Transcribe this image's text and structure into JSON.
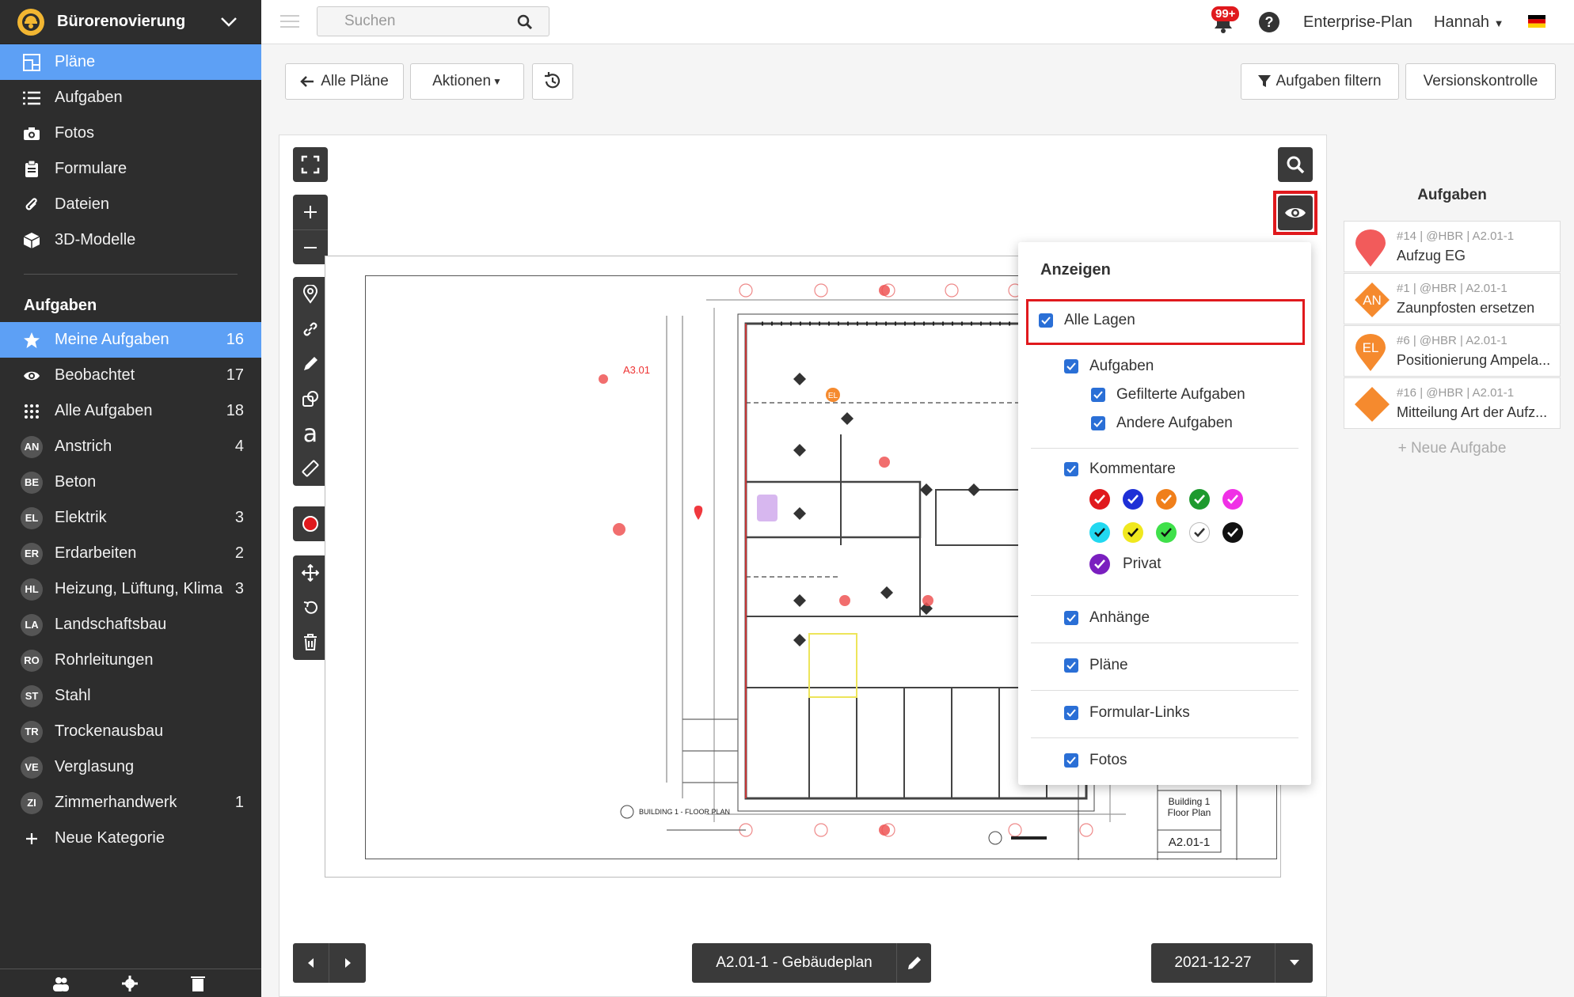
{
  "project": {
    "name": "Bürorenovierung"
  },
  "nav": [
    {
      "label": "Pläne",
      "icon": "plans-icon"
    },
    {
      "label": "Aufgaben",
      "icon": "list-icon"
    },
    {
      "label": "Fotos",
      "icon": "camera-icon"
    },
    {
      "label": "Formulare",
      "icon": "clipboard-icon"
    },
    {
      "label": "Dateien",
      "icon": "paperclip-icon"
    },
    {
      "label": "3D-Modelle",
      "icon": "cube-icon"
    }
  ],
  "tasks_section": {
    "title": "Aufgaben",
    "items": [
      {
        "label": "Meine Aufgaben",
        "count": "16",
        "icon": "star-icon"
      },
      {
        "label": "Beobachtet",
        "count": "17",
        "icon": "eye-icon"
      },
      {
        "label": "Alle Aufgaben",
        "count": "18",
        "icon": "grid-icon"
      }
    ],
    "categories": [
      {
        "abbr": "AN",
        "label": "Anstrich",
        "count": "4"
      },
      {
        "abbr": "BE",
        "label": "Beton",
        "count": ""
      },
      {
        "abbr": "EL",
        "label": "Elektrik",
        "count": "3"
      },
      {
        "abbr": "ER",
        "label": "Erdarbeiten",
        "count": "2"
      },
      {
        "abbr": "HL",
        "label": "Heizung, Lüftung, Klima",
        "count": "3"
      },
      {
        "abbr": "LA",
        "label": "Landschaftsbau",
        "count": ""
      },
      {
        "abbr": "RO",
        "label": "Rohrleitungen",
        "count": ""
      },
      {
        "abbr": "ST",
        "label": "Stahl",
        "count": ""
      },
      {
        "abbr": "TR",
        "label": "Trockenausbau",
        "count": ""
      },
      {
        "abbr": "VE",
        "label": "Verglasung",
        "count": ""
      },
      {
        "abbr": "ZI",
        "label": "Zimmerhandwerk",
        "count": "1"
      }
    ],
    "new_category": "Neue Kategorie"
  },
  "topbar": {
    "search_placeholder": "Suchen",
    "notifications": "99+",
    "help": "?",
    "plan": "Enterprise-Plan",
    "user": "Hannah"
  },
  "toolbar": {
    "all_plans": "Alle Pläne",
    "actions": "Aktionen",
    "filter_tasks": "Aufgaben filtern",
    "version_control": "Versionskontrolle"
  },
  "display_menu": {
    "title": "Anzeigen",
    "all_layers": "Alle Lagen",
    "tasks": "Aufgaben",
    "filtered_tasks": "Gefilterte Aufgaben",
    "other_tasks": "Andere Aufgaben",
    "comments": "Kommentare",
    "comment_colors": [
      "#e0191d",
      "#1e2fd6",
      "#f07f1a",
      "#1e9a2e",
      "#f030e6",
      "#22d8f0",
      "#f0e81e",
      "#3fe04a",
      "#ffffff",
      "#111111"
    ],
    "private_color": "#7a1fbf",
    "private": "Privat",
    "attachments": "Anhänge",
    "plans": "Pläne",
    "form_links": "Formular-Links",
    "photos": "Fotos"
  },
  "task_panel": {
    "title": "Aufgaben",
    "tasks": [
      {
        "meta": "#14 | @HBR | A2.01-1",
        "title": "Aufzug EG",
        "badge": "",
        "color": "#f25b5b",
        "shape": "pin"
      },
      {
        "meta": "#1 | @HBR | A2.01-1",
        "title": "Zaunpfosten ersetzen",
        "badge": "AN",
        "color": "#f58a2e",
        "shape": "diamond"
      },
      {
        "meta": "#6 | @HBR | A2.01-1",
        "title": "Positionierung Ampela...",
        "badge": "EL",
        "color": "#f58a2e",
        "shape": "pin"
      },
      {
        "meta": "#16 | @HBR | A2.01-1",
        "title": "Mitteilung Art der Aufz...",
        "badge": "",
        "color": "#f58a2e",
        "shape": "diamond"
      }
    ],
    "new_task": "+ Neue Aufgabe"
  },
  "drawing": {
    "sheet_ref": "A3.01",
    "pin_label": "EL",
    "title_block": [
      "Building 1",
      "Floor Plan"
    ],
    "sheet_number": "A2.01-1",
    "floor_plan_label": "BUILDING 1 - FLOOR PLAN"
  },
  "bottom": {
    "plan_title": "A2.01-1 - Gebäudeplan",
    "date": "2021-12-27"
  }
}
